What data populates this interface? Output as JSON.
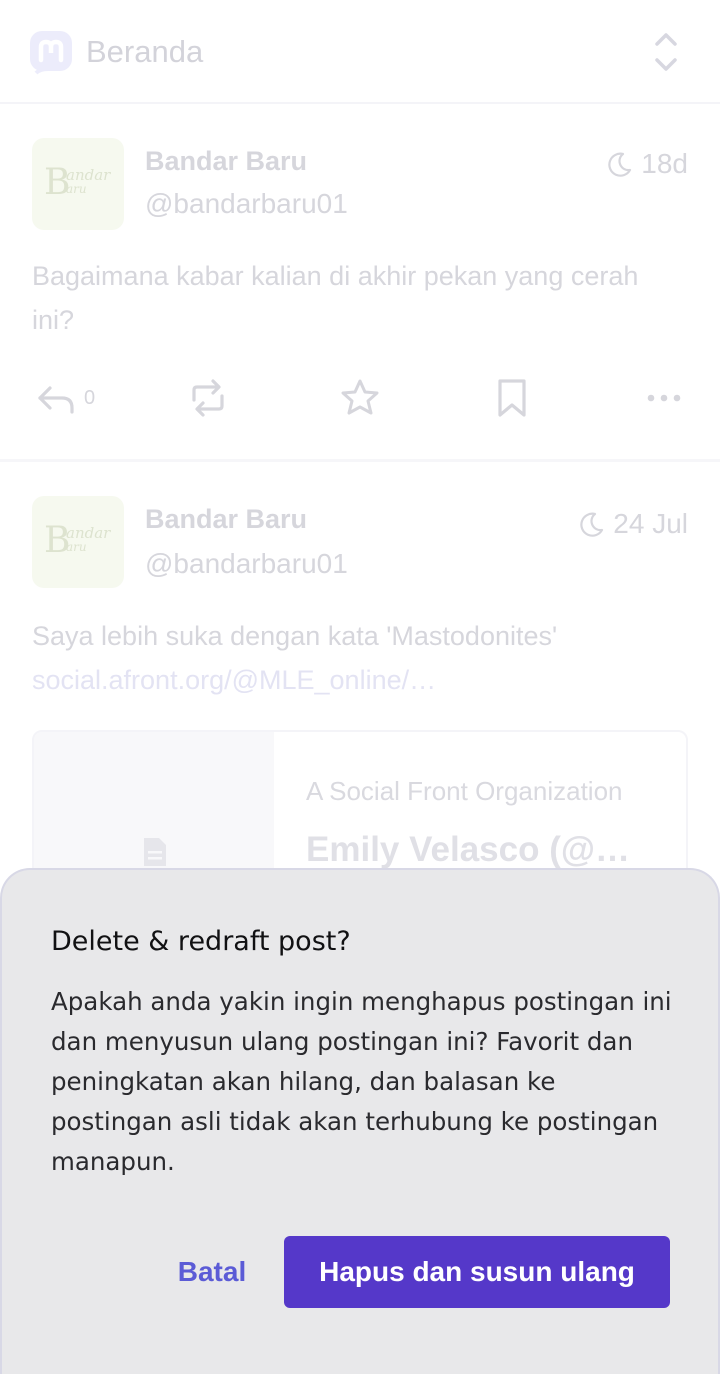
{
  "header": {
    "title": "Beranda"
  },
  "posts": [
    {
      "display_name": "Bandar Baru",
      "handle": "@bandarbaru01",
      "time": "18d",
      "text": "Bagaimana kabar kalian di akhir pekan yang cerah ini?",
      "reply_count": "0"
    },
    {
      "display_name": "Bandar Baru",
      "handle": "@bandarbaru01",
      "time": "24 Jul",
      "text": "Saya lebih suka dengan kata 'Mastodonites'",
      "link": "social.afront.org/@MLE_online/…",
      "card": {
        "provider": "A Social Front Organization",
        "title": "Emily Velasco (@…"
      }
    }
  ],
  "avatar_text": {
    "big": "B",
    "line1": "andar",
    "line2": "aru"
  },
  "dialog": {
    "title": "Delete & redraft post?",
    "body": "Apakah anda yakin ingin menghapus postingan ini dan menyusun ulang postingan ini? Favorit dan peningkatan akan hilang, dan balasan ke postingan asli tidak akan terhubung ke postingan manapun.",
    "cancel_label": "Batal",
    "confirm_label": "Hapus dan susun ulang"
  },
  "colors": {
    "accent": "#5538c9",
    "cancel_text": "#5b5bd6",
    "sheet_bg": "#e8e8ea"
  },
  "icons": [
    "mastodon-logo-icon",
    "sort-chevrons-icon",
    "moon-icon",
    "reply-icon",
    "boost-icon",
    "star-icon",
    "bookmark-icon",
    "more-icon",
    "document-icon"
  ]
}
